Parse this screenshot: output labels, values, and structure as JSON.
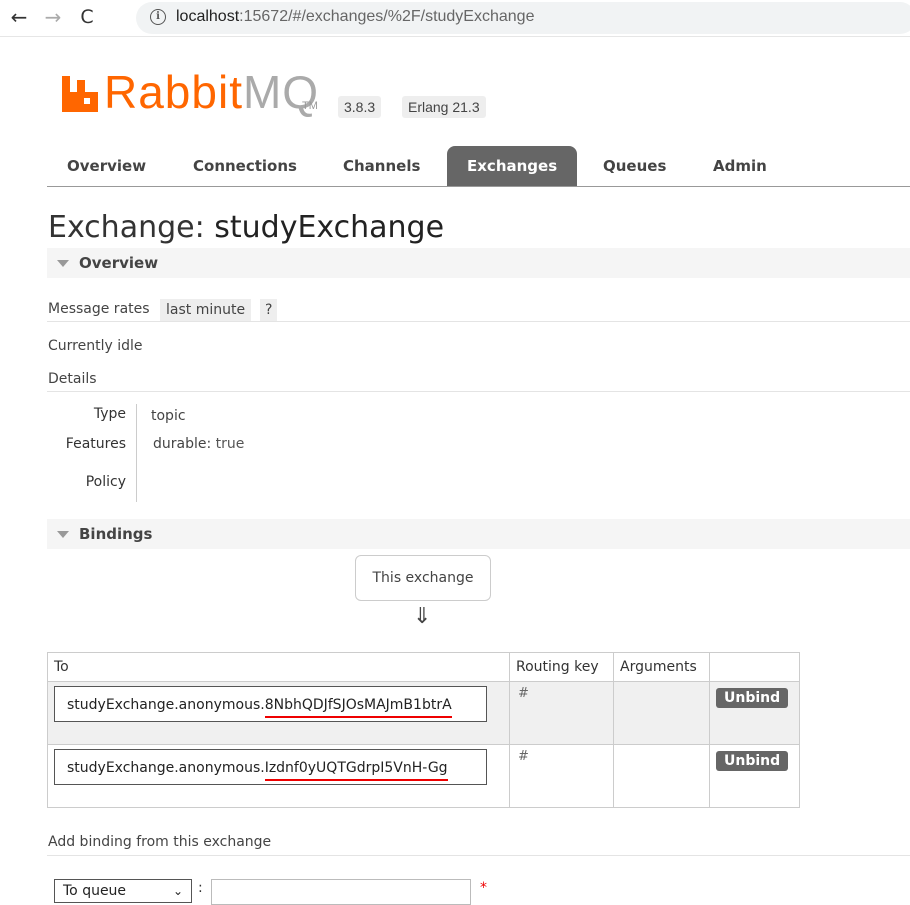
{
  "browser": {
    "back_glyph": "←",
    "forward_glyph": "→",
    "reload_glyph": "C",
    "info_glyph": "i",
    "url_host": "localhost",
    "url_rest": ":15672/#/exchanges/%2F/studyExchange"
  },
  "header": {
    "logo_rabbit": "Rabbit",
    "logo_mq": "MQ",
    "logo_tm": "TM",
    "version": "3.8.3",
    "erlang": "Erlang 21.3",
    "brand_color": "#ff6600"
  },
  "tabs": [
    {
      "label": "Overview",
      "active": false
    },
    {
      "label": "Connections",
      "active": false
    },
    {
      "label": "Channels",
      "active": false
    },
    {
      "label": "Exchanges",
      "active": true
    },
    {
      "label": "Queues",
      "active": false
    },
    {
      "label": "Admin",
      "active": false
    }
  ],
  "page": {
    "title_prefix": "Exchange:",
    "title_name": "studyExchange"
  },
  "overview": {
    "section_label": "Overview",
    "message_rates_label": "Message rates",
    "rate_period": "last minute",
    "help": "?",
    "status": "Currently idle",
    "details_label": "Details",
    "type_key": "Type",
    "type_value": "topic",
    "features_key": "Features",
    "features_value_key": "durable:",
    "features_value": "true",
    "policy_key": "Policy"
  },
  "bindings": {
    "section_label": "Bindings",
    "this_exchange": "This exchange",
    "arrow_glyph": "⇓",
    "columns": [
      "To",
      "Routing key",
      "Arguments",
      ""
    ],
    "rows": [
      {
        "queue_prefix": "studyExchange.anonymous.",
        "queue_suffix": "8NbhQDJfSJOsMAJmB1btrA",
        "routing_key": "#",
        "arguments": "",
        "action": "Unbind"
      },
      {
        "queue_prefix": "studyExchange.anonymous.",
        "queue_suffix": "Izdnf0yUQTGdrpI5VnH-Gg",
        "routing_key": "#",
        "arguments": "",
        "action": "Unbind"
      }
    ]
  },
  "add_binding": {
    "label": "Add binding from this exchange",
    "destination_select": "To queue",
    "chevron": "⌄",
    "colon": ":",
    "required": "*"
  }
}
